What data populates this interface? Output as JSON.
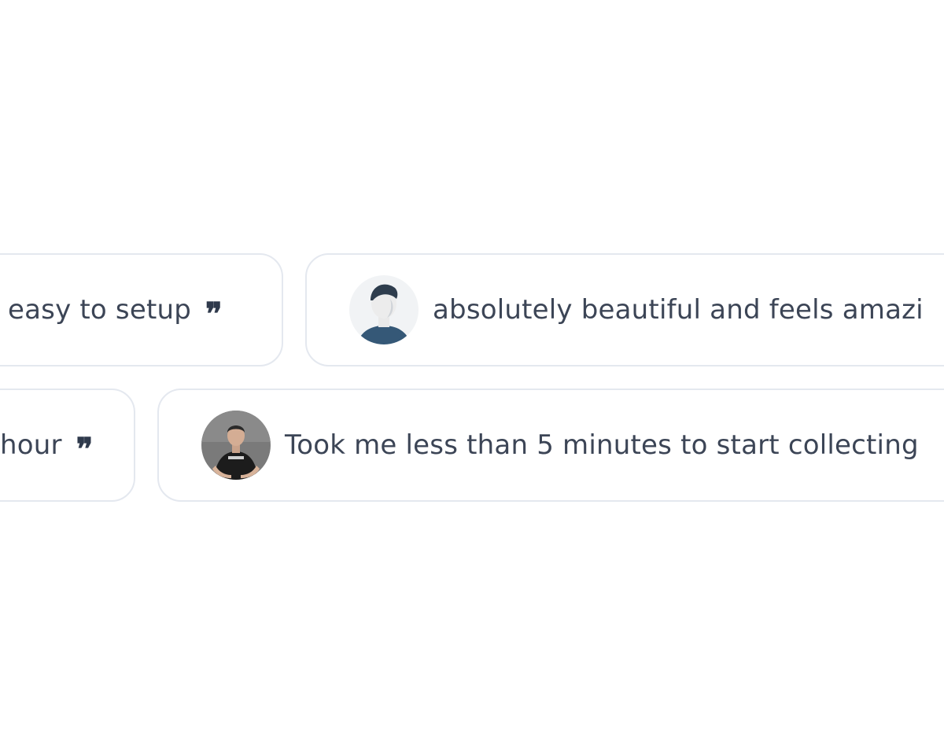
{
  "testimonials": [
    {
      "text": "easy to setup",
      "quote_icon": "closing-quote-icon"
    },
    {
      "text": "absolutely beautiful and feels amazi",
      "avatar": "avatar-man-short-hair"
    },
    {
      "text": "hour",
      "quote_icon": "closing-quote-icon"
    },
    {
      "text": "Took me less than 5 minutes to start collecting",
      "avatar": "avatar-man-black-tshirt"
    }
  ],
  "quote_glyph": "❞",
  "colors": {
    "background": "#ffffff",
    "card_border": "#e4e8ef",
    "text": "#3c4556",
    "quote": "#2f3a4c"
  }
}
